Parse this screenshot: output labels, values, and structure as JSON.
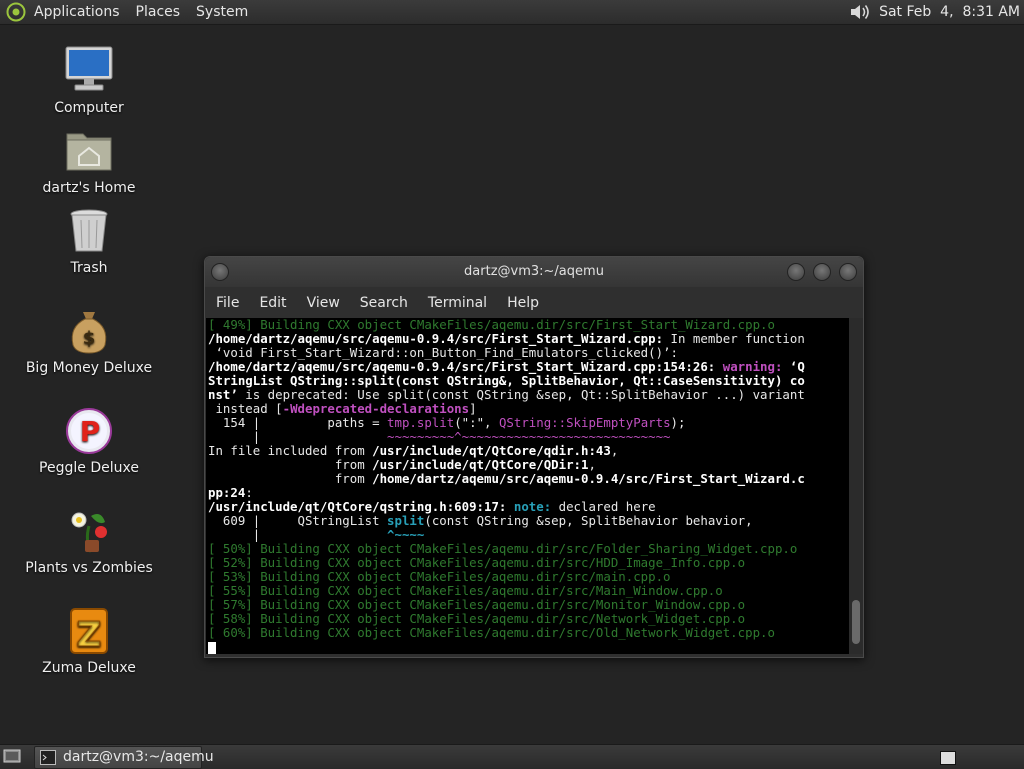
{
  "top_panel": {
    "menus": [
      "Applications",
      "Places",
      "System"
    ],
    "clock": "Sat Feb  4,  8:31 AM"
  },
  "desktop": {
    "icons": [
      {
        "label": "Computer",
        "icon": "computer-icon"
      },
      {
        "label": "dartz's Home",
        "icon": "home-folder-icon"
      },
      {
        "label": "Trash",
        "icon": "trash-icon"
      },
      {
        "label": "Big Money Deluxe",
        "icon": "money-bag-icon"
      },
      {
        "label": "Peggle Deluxe",
        "icon": "peggle-icon"
      },
      {
        "label": "Plants vs Zombies",
        "icon": "plants-icon"
      },
      {
        "label": "Zuma Deluxe",
        "icon": "zuma-icon"
      }
    ]
  },
  "terminal": {
    "title": "dartz@vm3:~/aqemu",
    "menus": [
      "File",
      "Edit",
      "View",
      "Search",
      "Terminal",
      "Help"
    ],
    "lines": {
      "l1": "[ 49%] Building CXX object CMakeFiles/aqemu.dir/src/First_Start_Wizard.cpp.o",
      "l2a": "/home/dartz/aqemu/src/aqemu-0.9.4/src/First_Start_Wizard.cpp:",
      "l2b": " In member function",
      "l3": " ‘void First_Start_Wizard::on_Button_Find_Emulators_clicked()’:",
      "l4a": "/home/dartz/aqemu/src/aqemu-0.9.4/src/First_Start_Wizard.cpp:154:26:",
      "l4b": " warning:",
      "l4c": " ‘Q",
      "l5": "StringList QString::split(const QString&, SplitBehavior, Qt::CaseSensitivity) co",
      "l6a": "nst’",
      "l6b": " is deprecated: Use split(const QString &sep, Qt::SplitBehavior ...) variant",
      "l7a": " instead [",
      "l7b": "-Wdeprecated-declarations",
      "l7c": "]",
      "l8a": "  154 |         paths = ",
      "l8b": "tmp.split",
      "l8c": "(\":\", ",
      "l8d": "QString::SkipEmptyParts",
      "l8d2": ");",
      "l9a": "      |",
      "l9b": "                 ~~~~~~~~~^~~~~~~~~~~~~~~~~~~~~~~~~~~~~",
      "l10a": "In file included from ",
      "l10b": "/usr/include/qt/QtCore/qdir.h:43",
      "l10c": ",",
      "l11a": "                 from ",
      "l11b": "/usr/include/qt/QtCore/QDir:1",
      "l11c": ",",
      "l12a": "                 from ",
      "l12b": "/home/dartz/aqemu/src/aqemu-0.9.4/src/First_Start_Wizard.c",
      "l13": "pp:24",
      "l13b": ":",
      "l14a": "/usr/include/qt/QtCore/qstring.h:609:17:",
      "l14b": " note:",
      "l14c": " declared here",
      "l15a": "  609 |     QStringList ",
      "l15b": "split",
      "l15c": "(const QString &sep, SplitBehavior behavior,",
      "l16a": "      |",
      "l16b": "                 ^~~~~",
      "l17": "[ 50%] Building CXX object CMakeFiles/aqemu.dir/src/Folder_Sharing_Widget.cpp.o",
      "l18": "[ 52%] Building CXX object CMakeFiles/aqemu.dir/src/HDD_Image_Info.cpp.o",
      "l19": "[ 53%] Building CXX object CMakeFiles/aqemu.dir/src/main.cpp.o",
      "l20": "[ 55%] Building CXX object CMakeFiles/aqemu.dir/src/Main_Window.cpp.o",
      "l21": "[ 57%] Building CXX object CMakeFiles/aqemu.dir/src/Monitor_Window.cpp.o",
      "l22": "[ 58%] Building CXX object CMakeFiles/aqemu.dir/src/Network_Widget.cpp.o",
      "l23": "[ 60%] Building CXX object CMakeFiles/aqemu.dir/src/Old_Network_Widget.cpp.o"
    }
  },
  "taskbar": {
    "task_label": "dartz@vm3:~/aqemu"
  }
}
